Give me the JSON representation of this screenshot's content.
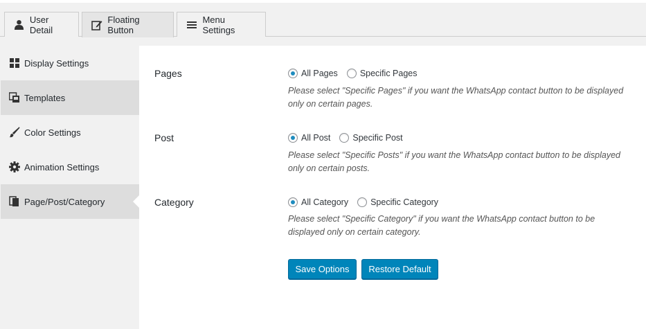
{
  "tabs": [
    {
      "label": "User Detail",
      "icon": "user-icon"
    },
    {
      "label": "Floating Button",
      "icon": "edit-icon"
    },
    {
      "label": "Menu Settings",
      "icon": "menu-icon"
    }
  ],
  "sidebar": {
    "items": [
      {
        "label": "Display Settings",
        "icon": "grid-icon"
      },
      {
        "label": "Templates",
        "icon": "templates-icon"
      },
      {
        "label": "Color Settings",
        "icon": "brush-icon"
      },
      {
        "label": "Animation Settings",
        "icon": "gear-icon"
      },
      {
        "label": "Page/Post/Category",
        "icon": "pages-icon"
      }
    ]
  },
  "form": {
    "pages": {
      "label": "Pages",
      "option_all": "All Pages",
      "option_specific": "Specific Pages",
      "selected": "All Pages",
      "description": "Please select \"Specific Pages\" if you want the WhatsApp contact button to be displayed only on certain pages."
    },
    "post": {
      "label": "Post",
      "option_all": "All Post",
      "option_specific": "Specific Post",
      "selected": "All Post",
      "description": "Please select \"Specific Posts\" if you want the WhatsApp contact button to be displayed only on certain posts."
    },
    "category": {
      "label": "Category",
      "option_all": "All Category",
      "option_specific": "Specific Category",
      "selected": "All Category",
      "description": "Please select \"Specific Category\" if you want the WhatsApp contact button to be displayed only on certain category."
    }
  },
  "buttons": {
    "save": "Save Options",
    "restore": "Restore Default"
  },
  "colors": {
    "primary_button": "#0085ba",
    "radio_dot": "#1e8cbe"
  }
}
